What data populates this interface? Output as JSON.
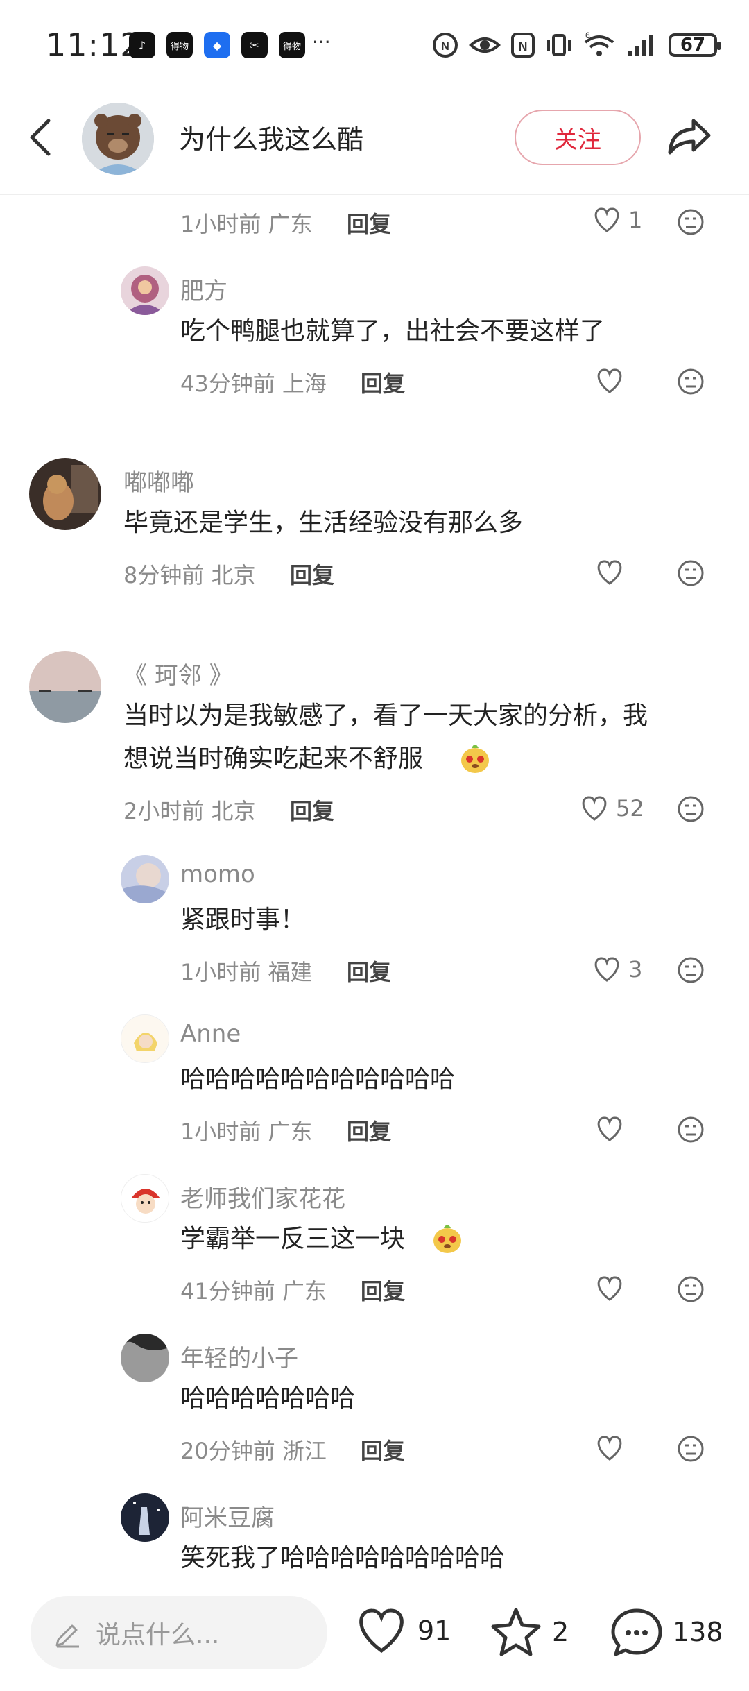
{
  "status_bar": {
    "time": "11:12",
    "apps": [
      "TikTok",
      "得物",
      "AI",
      "CapCut",
      "得物"
    ],
    "battery": "67"
  },
  "header": {
    "title": "为什么我这么酷",
    "follow_label": "关注"
  },
  "comments": {
    "c0": {
      "time": "1小时前",
      "location": "广东",
      "reply": "回复",
      "likes": "1"
    },
    "c1": {
      "name": "肥方",
      "text": "吃个鸭腿也就算了，出社会不要这样了",
      "time": "43分钟前",
      "location": "上海",
      "reply": "回复"
    },
    "c2": {
      "name": "嘟嘟嘟",
      "text": "毕竟还是学生，生活经验没有那么多",
      "time": "8分钟前",
      "location": "北京",
      "reply": "回复"
    },
    "c3": {
      "name": "《 珂邻 》",
      "text_line1": "当时以为是我敏感了，看了一天大家的分析，我",
      "text_line2": "想说当时确实吃起来不舒服",
      "time": "2小时前",
      "location": "北京",
      "reply": "回复",
      "likes": "52"
    },
    "c4": {
      "name": "momo",
      "text": "紧跟时事！",
      "time": "1小时前",
      "location": "福建",
      "reply": "回复",
      "likes": "3"
    },
    "c5": {
      "name": "Anne",
      "text": "哈哈哈哈哈哈哈哈哈哈哈",
      "time": "1小时前",
      "location": "广东",
      "reply": "回复"
    },
    "c6": {
      "name": "老师我们家花花",
      "text": "学霸举一反三这一块",
      "time": "41分钟前",
      "location": "广东",
      "reply": "回复"
    },
    "c7": {
      "name": "年轻的小子",
      "text": "哈哈哈哈哈哈哈",
      "time": "20分钟前",
      "location": "浙江",
      "reply": "回复"
    },
    "c8": {
      "name": "阿米豆腐",
      "text": "笑死我了哈哈哈哈哈哈哈哈哈"
    }
  },
  "bottom_bar": {
    "input_placeholder": "说点什么...",
    "likes": "91",
    "favorites": "2",
    "comments": "138"
  }
}
